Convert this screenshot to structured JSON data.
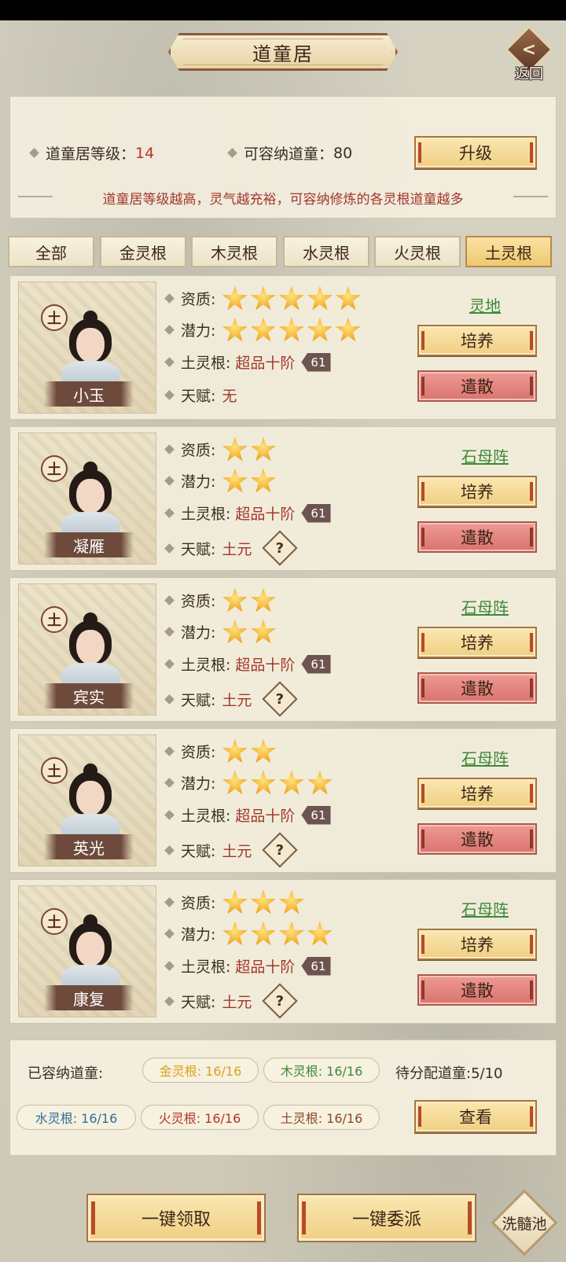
{
  "header": {
    "title": "道童居",
    "back_label": "返回"
  },
  "info": {
    "level_label": "道童居等级：",
    "level_value": "14",
    "capacity_label": "可容纳道童：",
    "capacity_value": "80",
    "upgrade_label": "升级",
    "description": "道童居等级越高，灵气越充裕，可容纳修炼的各灵根道童越多"
  },
  "tabs": [
    {
      "label": "全部"
    },
    {
      "label": "金灵根"
    },
    {
      "label": "木灵根"
    },
    {
      "label": "水灵根"
    },
    {
      "label": "火灵根"
    },
    {
      "label": "土灵根",
      "active": true
    }
  ],
  "labels": {
    "aptitude": "资质:",
    "potential": "潜力:",
    "root": "土灵根:",
    "talent": "天赋:",
    "element": "土",
    "cultivate": "培养",
    "dismiss": "遣散",
    "question": "?"
  },
  "disciples": [
    {
      "name": "小玉",
      "aptitude_stars": 5,
      "potential_stars": 5,
      "root_grade": "超品十阶",
      "root_level": "61",
      "talent": "无",
      "has_talent_icon": false,
      "location": "灵地"
    },
    {
      "name": "凝雁",
      "aptitude_stars": 2,
      "potential_stars": 2,
      "root_grade": "超品十阶",
      "root_level": "61",
      "talent": "土元",
      "has_talent_icon": true,
      "location": "石母阵"
    },
    {
      "name": "宾实",
      "aptitude_stars": 2,
      "potential_stars": 2,
      "root_grade": "超品十阶",
      "root_level": "61",
      "talent": "土元",
      "has_talent_icon": true,
      "location": "石母阵"
    },
    {
      "name": "英光",
      "aptitude_stars": 2,
      "potential_stars": 4,
      "root_grade": "超品十阶",
      "root_level": "61",
      "talent": "土元",
      "has_talent_icon": true,
      "location": "石母阵"
    },
    {
      "name": "康复",
      "aptitude_stars": 3,
      "potential_stars": 4,
      "root_grade": "超品十阶",
      "root_level": "61",
      "talent": "土元",
      "has_talent_icon": true,
      "location": "石母阵"
    }
  ],
  "summary": {
    "housed_label": "已容纳道童:",
    "pending_label": "待分配道童:",
    "pending_value": "5/10",
    "view_label": "查看",
    "roots": [
      {
        "text": "金灵根: 16/16",
        "color": "#d9a21e"
      },
      {
        "text": "木灵根: 16/16",
        "color": "#3c8a3a"
      },
      {
        "text": "水灵根: 16/16",
        "color": "#2f6f9e"
      },
      {
        "text": "火灵根: 16/16",
        "color": "#b3352b"
      },
      {
        "text": "土灵根: 16/16",
        "color": "#8a4a2a"
      }
    ]
  },
  "footer": {
    "claim_all": "一键领取",
    "dispatch_all": "一键委派",
    "pool": "洗髓池"
  },
  "colors": {
    "accent_red": "#b3352b",
    "accent_green": "#3c8a3a",
    "star_gold": "#f0a21e"
  }
}
